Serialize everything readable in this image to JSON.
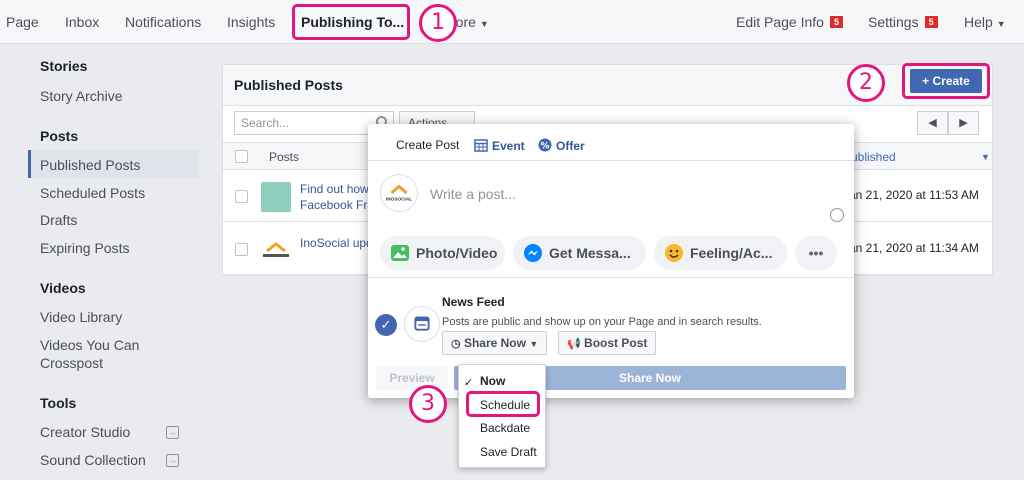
{
  "nav": {
    "items": [
      "Page",
      "Inbox",
      "Notifications",
      "Insights",
      "Publishing To...",
      "More"
    ],
    "edit_page_info": "Edit Page Info",
    "edit_page_info_badge": "5",
    "settings": "Settings",
    "settings_badge": "5",
    "help": "Help"
  },
  "annotations": {
    "step1": "1",
    "step2": "2",
    "step3": "3"
  },
  "sidebar": {
    "sections": [
      {
        "heading": "Stories",
        "items": [
          "Story Archive"
        ]
      },
      {
        "heading": "Posts",
        "items": [
          "Published Posts",
          "Scheduled Posts",
          "Drafts",
          "Expiring Posts"
        ]
      },
      {
        "heading": "Videos",
        "items": [
          "Video Library",
          "Videos You Can Crosspost"
        ]
      },
      {
        "heading": "Tools",
        "items": [
          "Creator Studio",
          "Sound Collection"
        ]
      }
    ],
    "active": "Published Posts"
  },
  "panel": {
    "title": "Published Posts",
    "search_placeholder": "Search...",
    "actions_label": "Actions",
    "columns": {
      "posts": "Posts",
      "published": "Published"
    },
    "rows": [
      {
        "title_line1": "Find out how",
        "title_line2": "Facebook Fri",
        "date": "Jan 21, 2020 at 11:53 AM"
      },
      {
        "title_line1": "InoSocial upd",
        "title_line2": "",
        "date": "Jan 21, 2020 at 11:34 AM"
      }
    ]
  },
  "create_button": "+ Create",
  "composer": {
    "tabs": [
      "Create Post",
      "Event",
      "Offer"
    ],
    "placeholder": "Write a post...",
    "avatar_label": "INOSOCIAL",
    "actions": [
      "Photo/Video",
      "Get Messa...",
      "Feeling/Ac...",
      "•••"
    ],
    "news_feed": {
      "title": "News Feed",
      "description": "Posts are public and show up on your Page and in search results."
    },
    "share_now_dropdown": "Share Now",
    "boost_post": "Boost Post",
    "preview": "Preview",
    "share_now": "Share Now"
  },
  "dropdown": {
    "items": [
      "Now",
      "Schedule",
      "Backdate",
      "Save Draft"
    ],
    "selected": "Now"
  },
  "colors": {
    "accent": "#4267b2",
    "highlight": "#e4157f",
    "badge": "#e02a2a"
  }
}
